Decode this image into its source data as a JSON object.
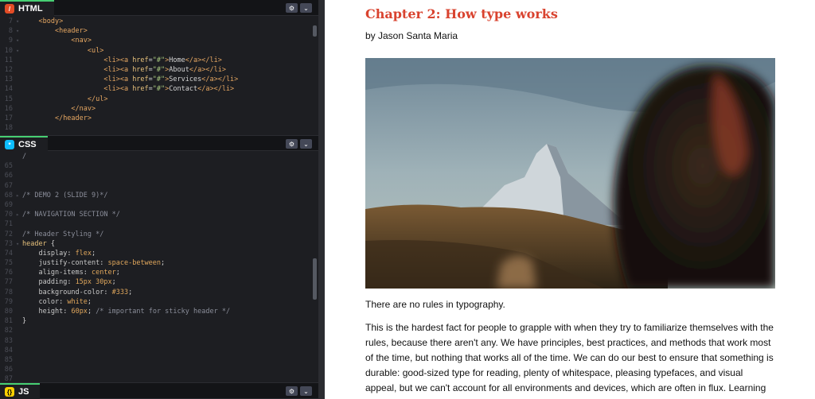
{
  "html_panel": {
    "tab_label": "HTML",
    "badge": "/",
    "lines": [
      {
        "n": "7",
        "fold": "▾",
        "html": "<span class='txt'>    </span><span class='tag'>&lt;body&gt;</span>"
      },
      {
        "n": "8",
        "fold": "▾",
        "html": "<span class='txt'>        </span><span class='tag'>&lt;header&gt;</span>"
      },
      {
        "n": "9",
        "fold": "▾",
        "html": "<span class='txt'>            </span><span class='tag'>&lt;nav&gt;</span>"
      },
      {
        "n": "10",
        "fold": "▾",
        "html": "<span class='txt'>                </span><span class='tag'>&lt;ul&gt;</span>"
      },
      {
        "n": "11",
        "fold": "",
        "html": "<span class='txt'>                    </span><span class='tag'>&lt;li&gt;&lt;a </span><span class='an'>href</span><span class='txt'>=</span><span class='av'>\"#\"</span><span class='tag'>&gt;</span><span class='txt'>Home</span><span class='tag'>&lt;/a&gt;&lt;/li&gt;</span>"
      },
      {
        "n": "12",
        "fold": "",
        "html": "<span class='txt'>                    </span><span class='tag'>&lt;li&gt;&lt;a </span><span class='an'>href</span><span class='txt'>=</span><span class='av'>\"#\"</span><span class='tag'>&gt;</span><span class='txt'>About</span><span class='tag'>&lt;/a&gt;&lt;/li&gt;</span>"
      },
      {
        "n": "13",
        "fold": "",
        "html": "<span class='txt'>                    </span><span class='tag'>&lt;li&gt;&lt;a </span><span class='an'>href</span><span class='txt'>=</span><span class='av'>\"#\"</span><span class='tag'>&gt;</span><span class='txt'>Services</span><span class='tag'>&lt;/a&gt;&lt;/li&gt;</span>"
      },
      {
        "n": "14",
        "fold": "",
        "html": "<span class='txt'>                    </span><span class='tag'>&lt;li&gt;&lt;a </span><span class='an'>href</span><span class='txt'>=</span><span class='av'>\"#\"</span><span class='tag'>&gt;</span><span class='txt'>Contact</span><span class='tag'>&lt;/a&gt;&lt;/li&gt;</span>"
      },
      {
        "n": "15",
        "fold": "",
        "html": "<span class='txt'>                </span><span class='tag'>&lt;/ul&gt;</span>"
      },
      {
        "n": "16",
        "fold": "",
        "html": "<span class='txt'>            </span><span class='tag'>&lt;/nav&gt;</span>"
      },
      {
        "n": "17",
        "fold": "",
        "html": "<span class='txt'>        </span><span class='tag'>&lt;/header&gt;</span>"
      },
      {
        "n": "18",
        "fold": "",
        "html": ""
      }
    ]
  },
  "css_panel": {
    "tab_label": "CSS",
    "badge": "*",
    "lines": [
      {
        "n": "",
        "fold": "",
        "html": "<span class='cm'>/</span>"
      },
      {
        "n": "65",
        "fold": "",
        "html": ""
      },
      {
        "n": "66",
        "fold": "",
        "html": ""
      },
      {
        "n": "67",
        "fold": "",
        "html": ""
      },
      {
        "n": "68",
        "fold": "▸",
        "html": "<span class='cm'>/* DEMO 2 (SLIDE 9)*/</span>"
      },
      {
        "n": "69",
        "fold": "",
        "html": ""
      },
      {
        "n": "70",
        "fold": "▸",
        "html": "<span class='cm'>/* NAVIGATION SECTION */</span>"
      },
      {
        "n": "71",
        "fold": "",
        "html": ""
      },
      {
        "n": "72",
        "fold": "",
        "html": "<span class='cm'>/* Header Styling */</span>"
      },
      {
        "n": "73",
        "fold": "▾",
        "html": "<span class='sel'>header</span><span class='txt'> {</span>"
      },
      {
        "n": "74",
        "fold": "",
        "html": "<span class='txt'>    </span><span class='prop'>display</span><span class='txt'>: </span><span class='val'>flex</span><span class='txt'>;</span>"
      },
      {
        "n": "75",
        "fold": "",
        "html": "<span class='txt'>    </span><span class='prop'>justify-content</span><span class='txt'>: </span><span class='val'>space-between</span><span class='txt'>;</span>"
      },
      {
        "n": "76",
        "fold": "",
        "html": "<span class='txt'>    </span><span class='prop'>align-items</span><span class='txt'>: </span><span class='val'>center</span><span class='txt'>;</span>"
      },
      {
        "n": "77",
        "fold": "",
        "html": "<span class='txt'>    </span><span class='prop'>padding</span><span class='txt'>: </span><span class='val'>15px 30px</span><span class='txt'>;</span>"
      },
      {
        "n": "78",
        "fold": "",
        "html": "<span class='txt'>    </span><span class='prop'>background-color</span><span class='txt'>: </span><span class='val'>#333</span><span class='txt'>;</span>"
      },
      {
        "n": "79",
        "fold": "",
        "html": "<span class='txt'>    </span><span class='prop'>color</span><span class='txt'>: </span><span class='val'>white</span><span class='txt'>;</span>"
      },
      {
        "n": "80",
        "fold": "",
        "html": "<span class='txt'>    </span><span class='prop'>height</span><span class='txt'>: </span><span class='val'>60px</span><span class='txt'>; </span><span class='cm'>/* important for sticky header */</span>"
      },
      {
        "n": "81",
        "fold": "",
        "html": "<span class='txt'>}</span>"
      },
      {
        "n": "82",
        "fold": "",
        "html": ""
      },
      {
        "n": "83",
        "fold": "",
        "html": ""
      },
      {
        "n": "84",
        "fold": "",
        "html": ""
      },
      {
        "n": "85",
        "fold": "",
        "html": ""
      },
      {
        "n": "86",
        "fold": "",
        "html": ""
      },
      {
        "n": "87",
        "fold": "",
        "html": ""
      }
    ]
  },
  "js_panel": {
    "tab_label": "JS",
    "badge": "{}"
  },
  "panel_controls": {
    "settings_icon": "⚙",
    "collapse_icon": "⌄"
  },
  "preview": {
    "chapter_title": "Chapter 2: How type works",
    "byline": "by Jason Santa Maria",
    "paragraph_1": "There are no rules in typography.",
    "paragraph_2": "This is the hardest fact for people to grapple with when they try to familiarize themselves with the rules, because there aren't any. We have principles, best practices, and methods that work most of the time, but nothing that works all of the time. We can do our best to ensure that something is durable: good-sized type for reading, plenty of whitespace, pleasing typefaces, and visual appeal, but we can't account for all environments and devices, which are often in flux. Learning typography is about figuring out what choices work best for each situation."
  },
  "colors": {
    "editor_bg": "#1d1e22",
    "chapter_title": "#d9432f",
    "html_badge": "#e34c26",
    "css_badge": "#0ebeff",
    "js_badge": "#fcd000"
  }
}
